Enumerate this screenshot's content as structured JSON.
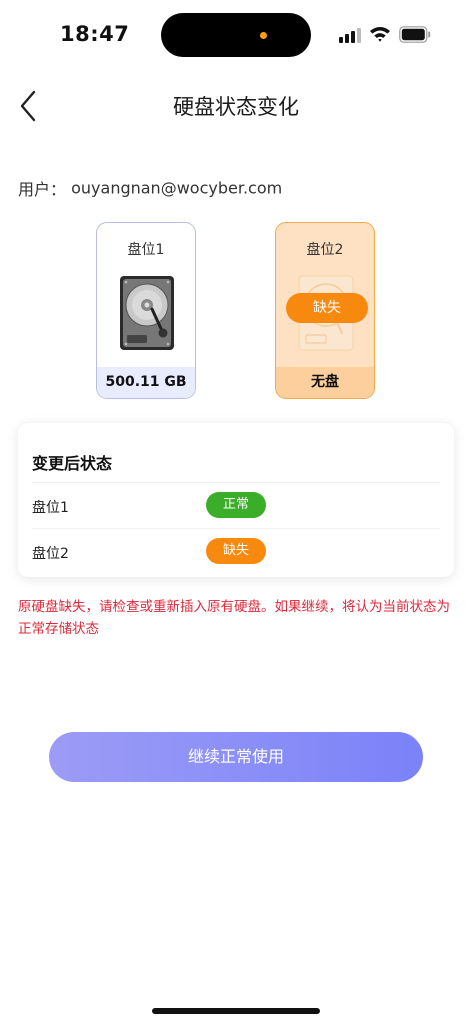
{
  "status_bar": {
    "time": "18:47"
  },
  "header": {
    "title": "硬盘状态变化"
  },
  "user": {
    "label": "用户：",
    "email": "ouyangnan@wocyber.com"
  },
  "bays": [
    {
      "label": "盘位1",
      "footer": "500.11 GB",
      "state": "present"
    },
    {
      "label": "盘位2",
      "footer": "无盘",
      "badge": "缺失",
      "state": "missing"
    }
  ],
  "status_card": {
    "title": "变更后状态",
    "rows": [
      {
        "label": "盘位1",
        "status": "正常",
        "color": "#3aae28"
      },
      {
        "label": "盘位2",
        "status": "缺失",
        "color": "#f6890e"
      }
    ]
  },
  "warning": "原硬盘缺失，请检查或重新插入原有硬盘。如果继续，将认为当前状态为正常存储状态",
  "continue_button": "继续正常使用",
  "icons": [
    "back-arrow-icon",
    "signal-icon",
    "wifi-icon",
    "battery-icon",
    "hard-disk-icon"
  ]
}
